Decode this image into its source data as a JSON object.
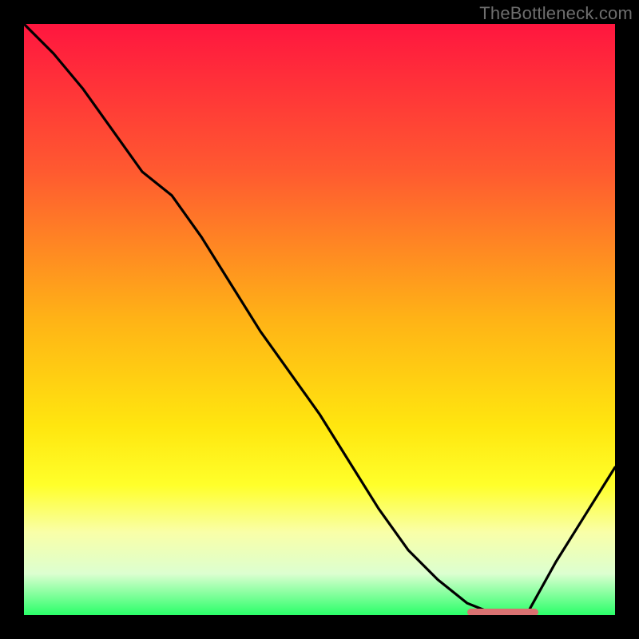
{
  "watermark": "TheBottleneck.com",
  "colors": {
    "background": "#000000",
    "curve": "#000000",
    "marker": "#d97171",
    "watermark_text": "#6e6e6e",
    "gradient_stops": [
      "#ff163f",
      "#ff5a30",
      "#ffb316",
      "#ffe60f",
      "#ffff2a",
      "#f9ffa8",
      "#dcffd0",
      "#2aff69"
    ]
  },
  "chart_data": {
    "type": "line",
    "title": "",
    "xlabel": "",
    "ylabel": "",
    "xlim": [
      0,
      100
    ],
    "ylim": [
      0,
      100
    ],
    "grid": false,
    "series": [
      {
        "name": "bottleneck-curve",
        "x": [
          0,
          5,
          10,
          15,
          20,
          25,
          30,
          35,
          40,
          45,
          50,
          55,
          60,
          65,
          70,
          75,
          80,
          83,
          85,
          90,
          95,
          100
        ],
        "values": [
          100,
          95,
          89,
          82,
          75,
          71,
          64,
          56,
          48,
          41,
          34,
          26,
          18,
          11,
          6,
          2,
          0,
          0,
          0,
          9,
          17,
          25
        ]
      }
    ],
    "annotations": [
      {
        "name": "optimal-marker",
        "x_start": 75,
        "x_end": 87,
        "y": 0
      }
    ]
  }
}
